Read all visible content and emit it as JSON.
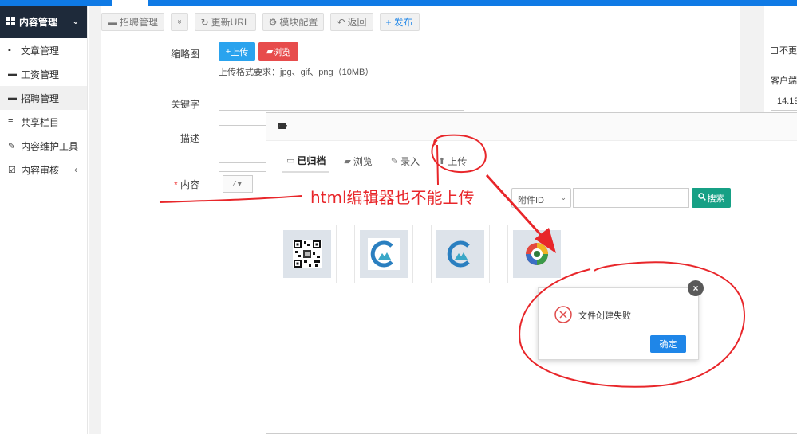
{
  "sidebar": {
    "header_label": "内容管理",
    "items": [
      {
        "label": "文章管理",
        "icon": "document-icon"
      },
      {
        "label": "工资管理",
        "icon": "credit-card-icon"
      },
      {
        "label": "招聘管理",
        "icon": "briefcase-icon"
      },
      {
        "label": "共享栏目",
        "icon": "list-icon"
      },
      {
        "label": "内容维护工具",
        "icon": "wrench-icon"
      },
      {
        "label": "内容审核",
        "icon": "edit-icon"
      }
    ]
  },
  "toolbar": {
    "recruit_label": "招聘管理",
    "collapse_label": "»",
    "update_url_label": "更新URL",
    "module_config_label": "模块配置",
    "back_label": "返回",
    "publish_label": "发布"
  },
  "form": {
    "thumbnail_label": "缩略图",
    "upload_label": "上传",
    "browse_label": "浏览",
    "format_hint": "上传格式要求：jpg、gif、png（10MB）",
    "keywords_label": "关键字",
    "description_label": "描述",
    "content_label": "内容",
    "required_mark": "*"
  },
  "right_panel": {
    "checkbox_label": "不更",
    "client_label": "客户端",
    "client_value": "14.19"
  },
  "modal": {
    "tabs": [
      {
        "label": "已归档",
        "icon": "archive-icon"
      },
      {
        "label": "浏览",
        "icon": "folder-icon"
      },
      {
        "label": "录入",
        "icon": "edit-icon"
      },
      {
        "label": "上传",
        "icon": "upload-icon"
      }
    ],
    "select_value": "附件ID",
    "search_label": "搜索"
  },
  "alert": {
    "message": "文件创建失败",
    "ok_label": "确定"
  },
  "annotation": {
    "text": "html编辑器也不能上传",
    "color": "#e8262a"
  },
  "colors": {
    "accent_blue": "#1f86e8",
    "sidebar_dark": "#1e2a3a",
    "danger_red": "#e74c4c",
    "search_green": "#16a085"
  }
}
